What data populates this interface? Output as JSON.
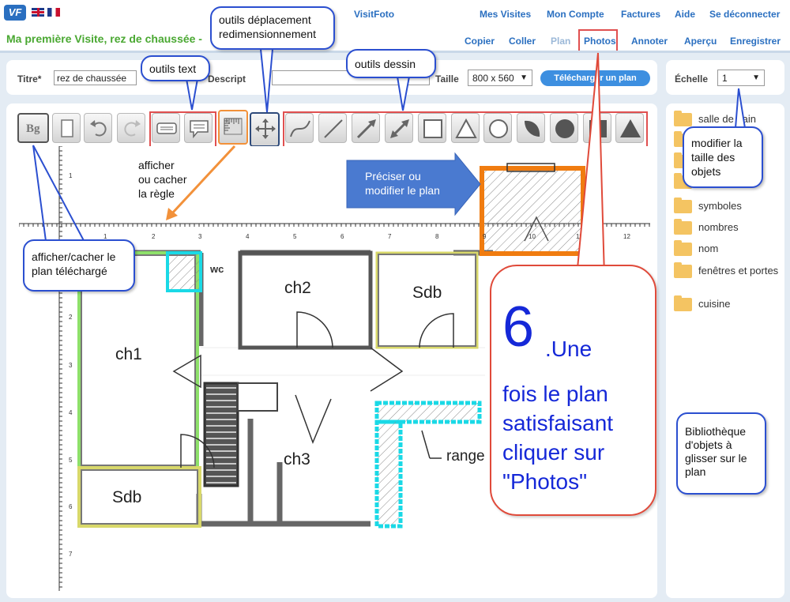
{
  "header": {
    "logo": "VF",
    "brand": "VisitFoto",
    "top_nav": [
      "Mes Visites",
      "Mon Compte",
      "Factures",
      "Aide",
      "Se déconnecter"
    ],
    "visit_title": "Ma première Visite, rez de chaussée -",
    "sub_nav": [
      "Copier",
      "Coller",
      "Plan",
      "Photos",
      "Annoter",
      "Aperçu",
      "Enregistrer"
    ]
  },
  "form": {
    "title_label": "Titre*",
    "title_value": "rez de chaussée",
    "desc_label": "Descript",
    "desc_value": "",
    "size_label": "Taille",
    "size_value": "800 x 560",
    "upload_button": "Télécharger un plan",
    "scale_label": "Échelle",
    "scale_value": "1"
  },
  "toolbar": {
    "bg_label": "Bg",
    "icons": [
      "bg-toggle-icon",
      "blank-page-icon",
      "undo-icon",
      "redo-icon",
      "text-box-icon",
      "speech-bubble-icon",
      "ruler-icon",
      "move-arrows-icon",
      "curve-icon",
      "line-icon",
      "arrow-icon",
      "double-arrow-icon",
      "square-icon",
      "triangle-icon",
      "circle-icon",
      "quarter-circle-icon",
      "filled-circle-icon",
      "filled-square-icon",
      "filled-triangle-icon"
    ]
  },
  "ruler": {
    "h_labels": [
      "1",
      "2",
      "3",
      "4",
      "5",
      "6",
      "7",
      "8",
      "9",
      "10",
      "11",
      "12"
    ],
    "v_labels": [
      "1",
      "2",
      "3",
      "4",
      "5",
      "6",
      "7"
    ]
  },
  "plan": {
    "rooms": [
      "ch1",
      "ch2",
      "Sdb",
      "Sdb",
      "ch3",
      "range",
      "wc"
    ]
  },
  "library": {
    "items": [
      "salle de bain",
      "symboles",
      "nombres",
      "nom",
      "fenêtres et portes",
      "cuisine"
    ]
  },
  "callouts": {
    "move_tools": [
      "outils déplacement",
      "redimensionnement"
    ],
    "text_tools": "outils text",
    "draw_tools": "outils dessin",
    "ruler_toggle": [
      "afficher",
      "ou cacher",
      "la règle"
    ],
    "plan_toggle": [
      "afficher/cacher le",
      "plan téléchargé"
    ],
    "refine": [
      "Préciser ou",
      "modifier le plan"
    ],
    "scale": [
      "modifier la",
      "taille des",
      "objets"
    ],
    "library": [
      "Bibliothèque",
      "d'objets à",
      "glisser sur le",
      "plan"
    ],
    "photos_number": "6",
    "photos_text": [
      ".Une",
      "fois le plan",
      "satisfaisant",
      "cliquer sur",
      "\"Photos\""
    ]
  },
  "colors": {
    "link_blue": "#2a6fc0",
    "green_title": "#4aa832",
    "callout_border": "#2b4fd0",
    "highlight_red": "#e05050",
    "highlight_orange": "#f2913a",
    "accent_blue": "#3d8fe0",
    "shape_cyan": "#1ad9e6",
    "shape_orange": "#f07c10"
  }
}
